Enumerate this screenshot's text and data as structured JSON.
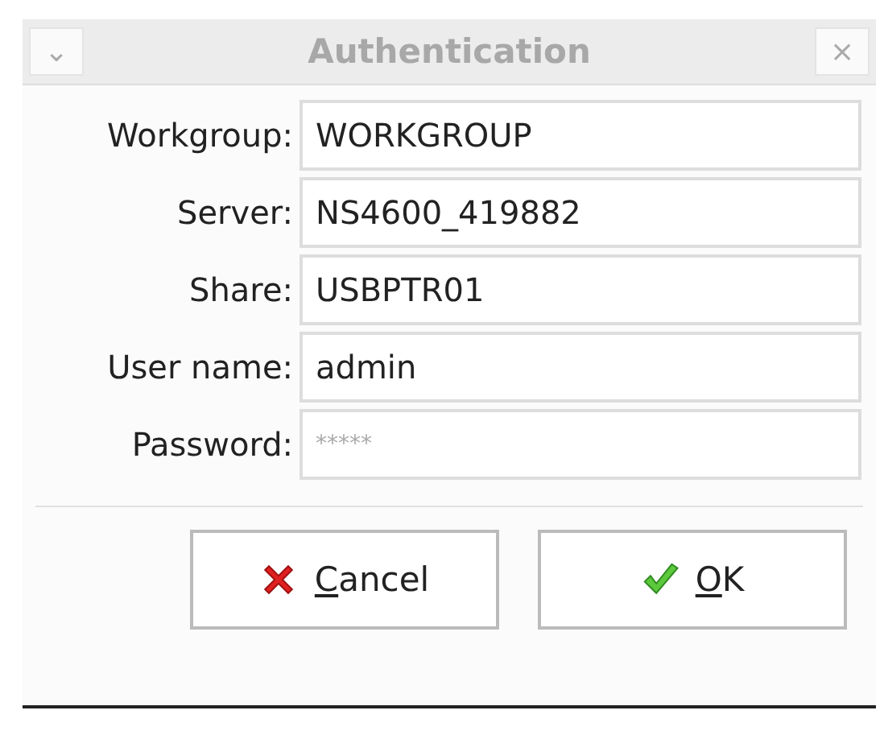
{
  "window": {
    "title": "Authentication",
    "menu_glyph": "⌄",
    "close_glyph": "×"
  },
  "fields": [
    {
      "label": "Workgroup:",
      "value": "WORKGROUP",
      "kind": "text"
    },
    {
      "label": "Server:",
      "value": "NS4600_419882",
      "kind": "text"
    },
    {
      "label": "Share:",
      "value": "USBPTR01",
      "kind": "text"
    },
    {
      "label": "User name:",
      "value": "admin",
      "kind": "text"
    },
    {
      "label": "Password:",
      "value": "*****",
      "kind": "password"
    }
  ],
  "buttons": [
    {
      "mnemonic": "C",
      "rest": "ancel",
      "kind": "cancel"
    },
    {
      "mnemonic": "O",
      "rest": "K",
      "kind": "ok"
    }
  ]
}
